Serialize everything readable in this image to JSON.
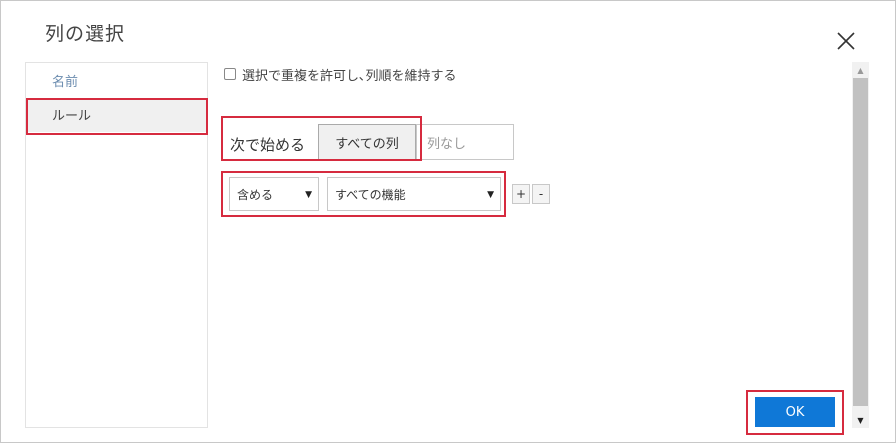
{
  "dialog": {
    "title": "列の選択",
    "close_icon": "close-icon"
  },
  "sidebar": {
    "items": [
      {
        "label": "名前"
      },
      {
        "label": "ルール"
      }
    ]
  },
  "options": {
    "allow_duplicates_label": "選択で重複を許可し､列順を維持する",
    "allow_duplicates_checked": false
  },
  "rule": {
    "start_label": "次で始める",
    "start_options": [
      "すべての列",
      "列なし"
    ],
    "start_selected": "すべての列",
    "condition_select": "含める",
    "target_select": "すべての機能",
    "add_label": "+",
    "remove_label": "-"
  },
  "footer": {
    "ok_label": "OK"
  },
  "colors": {
    "accent": "#0f78d7",
    "highlight": "#d62b3f"
  }
}
